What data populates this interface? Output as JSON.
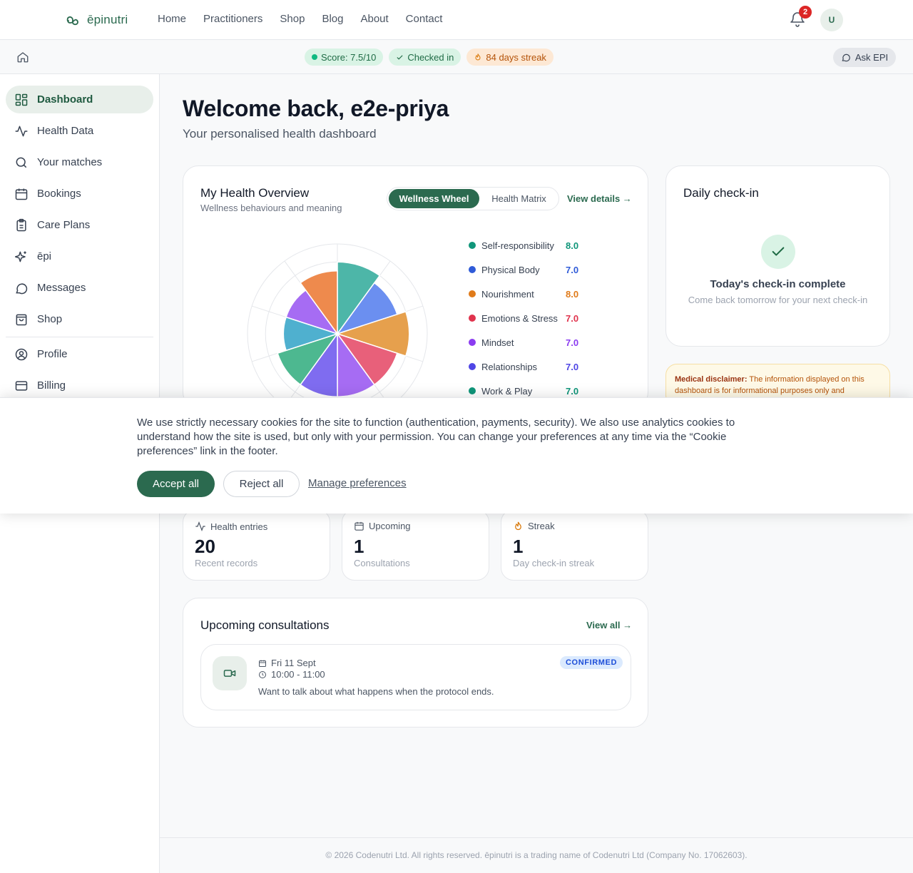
{
  "brand": {
    "name": "ēpinutri",
    "logo_icon": "infinity-leaf-icon"
  },
  "nav": {
    "links": [
      "Home",
      "Practitioners",
      "Shop",
      "Blog",
      "About",
      "Contact"
    ],
    "notification_count": "2",
    "avatar_initial": "U"
  },
  "status": {
    "score": "Score: 7.5/10",
    "checked": "Checked in",
    "streak": "84 days streak",
    "ask": "Ask EPI"
  },
  "sidebar": {
    "items": [
      {
        "label": "Dashboard",
        "icon": "grid-icon",
        "active": true
      },
      {
        "label": "Health Data",
        "icon": "activity-icon"
      },
      {
        "label": "Your matches",
        "icon": "search-icon"
      },
      {
        "label": "Bookings",
        "icon": "calendar-icon"
      },
      {
        "label": "Care Plans",
        "icon": "clipboard-icon"
      },
      {
        "label": "ēpi",
        "icon": "sparkles-icon"
      },
      {
        "label": "Messages",
        "icon": "chat-icon"
      },
      {
        "label": "Shop",
        "icon": "bag-icon"
      },
      {
        "label": "Profile",
        "icon": "user-circle-icon"
      },
      {
        "label": "Billing",
        "icon": "credit-card-icon"
      }
    ]
  },
  "main": {
    "welcome": "Welcome back, e2e-priya",
    "subtitle": "Your personalised health dashboard"
  },
  "overview": {
    "title": "My Health Overview",
    "subtitle": "Wellness behaviours and meaning",
    "toggle_active": "Wellness Wheel",
    "toggle_inactive": "Health Matrix",
    "view_details": "View details →"
  },
  "chart_data": {
    "type": "polar-area",
    "max": 10,
    "series": [
      {
        "name": "Self-responsibility",
        "value": 8.0,
        "display": "8.0",
        "color": "#10967a"
      },
      {
        "name": "Physical Body",
        "value": 7.0,
        "display": "7.0",
        "color": "#2f5bd8"
      },
      {
        "name": "Nourishment",
        "value": 8.0,
        "display": "8.0",
        "color": "#e07b1a"
      },
      {
        "name": "Emotions & Stress",
        "value": 7.0,
        "display": "7.0",
        "color": "#e0334d"
      },
      {
        "name": "Mindset",
        "value": 7.0,
        "display": "7.0",
        "color": "#8b3cf0"
      },
      {
        "name": "Relationships",
        "value": 7.0,
        "display": "7.0",
        "color": "#4f46e5"
      },
      {
        "name": "Work & Play",
        "value": 7.0,
        "display": "7.0",
        "color": "#10967a"
      }
    ],
    "wedge_fills": [
      "#4db6a8",
      "#6b8ff0",
      "#e6a04d",
      "#e8607a",
      "#a66cf3",
      "#7f6cf0",
      "#4db890",
      "#4fb0cf",
      "#a66cf3",
      "#ee8a4d"
    ],
    "wedge_values": [
      8.0,
      7.0,
      8.0,
      7.0,
      7.0,
      7.0,
      7.0,
      6.0,
      6.0,
      7.0
    ]
  },
  "checkin": {
    "title": "Daily check-in",
    "done": "Today's check-in complete",
    "next": "Come back tomorrow for your next check-in"
  },
  "disclaimer": {
    "label": "Medical disclaimer:",
    "text": "The information displayed on this dashboard is for informational purposes only and"
  },
  "stats": [
    {
      "label": "Health entries",
      "icon": "activity-icon",
      "value": "20",
      "sub": "Recent records"
    },
    {
      "label": "Upcoming",
      "icon": "calendar-icon",
      "value": "1",
      "sub": "Consultations"
    },
    {
      "label": "Streak",
      "icon": "flame-icon",
      "value": "1",
      "sub": "Day check-in streak"
    }
  ],
  "consultations": {
    "title": "Upcoming consultations",
    "view_all": "View all →",
    "appointment": {
      "date": "Fri 11 Sept",
      "time": "10:00 - 11:00",
      "note": "Want to talk about what happens when the protocol ends.",
      "status": "CONFIRMED"
    }
  },
  "footer": "© 2026 Codenutri Ltd. All rights reserved. ēpinutri is a trading name of Codenutri Ltd (Company No. 17062603).",
  "cookie": {
    "text": "We use strictly necessary cookies for the site to function (authentication, payments, security). We also use analytics cookies to understand how the site is used, but only with your permission. You can change your preferences at any time via the “Cookie preferences” link in the footer.",
    "accept": "Accept all",
    "reject": "Reject all",
    "manage": "Manage preferences"
  }
}
